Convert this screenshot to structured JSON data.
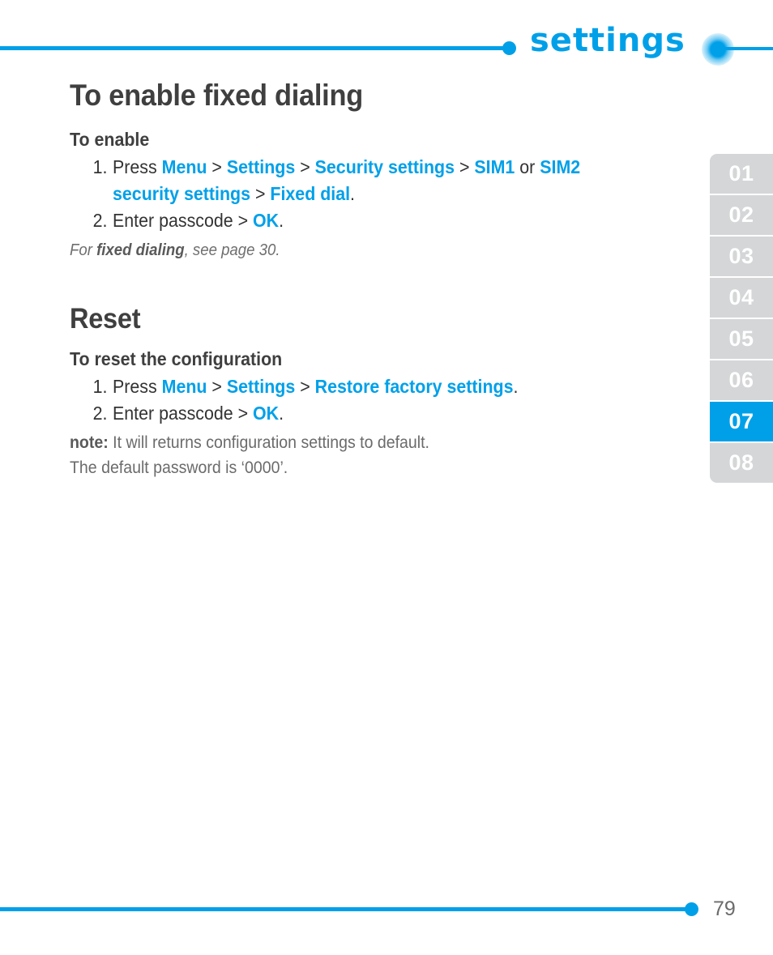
{
  "header": {
    "title": "settings",
    "accent_color": "#00a0e9"
  },
  "main": {
    "page_title": "To enable fixed dialing",
    "enable_section": {
      "sub_heading": "To enable",
      "steps": [
        {
          "num": "1.",
          "parts": [
            {
              "text": "Press ",
              "style": "plain"
            },
            {
              "text": "Menu",
              "style": "hl"
            },
            {
              "text": " > ",
              "style": "sep"
            },
            {
              "text": "Settings",
              "style": "hl"
            },
            {
              "text": " > ",
              "style": "sep"
            },
            {
              "text": "Security settings",
              "style": "hl"
            },
            {
              "text": " > ",
              "style": "sep"
            },
            {
              "text": "SIM1",
              "style": "hl"
            },
            {
              "text": " or ",
              "style": "plain"
            },
            {
              "text": "SIM2 security settings",
              "style": "hl"
            },
            {
              "text": " > ",
              "style": "sep"
            },
            {
              "text": "Fixed dial",
              "style": "hl"
            },
            {
              "text": ".",
              "style": "plain"
            }
          ]
        },
        {
          "num": "2.",
          "parts": [
            {
              "text": "Enter passcode > ",
              "style": "plain"
            },
            {
              "text": "OK",
              "style": "hl"
            },
            {
              "text": ".",
              "style": "plain"
            }
          ]
        }
      ],
      "xref_before": "For ",
      "xref_bold": "fixed dialing",
      "xref_after": ", see page 30."
    },
    "reset_section": {
      "heading": "Reset",
      "sub_heading": "To reset the configuration",
      "steps": [
        {
          "num": "1.",
          "parts": [
            {
              "text": "Press ",
              "style": "plain"
            },
            {
              "text": "Menu",
              "style": "hl"
            },
            {
              "text": " > ",
              "style": "sep"
            },
            {
              "text": "Settings",
              "style": "hl"
            },
            {
              "text": " > ",
              "style": "sep"
            },
            {
              "text": "Restore factory settings",
              "style": "hl"
            },
            {
              "text": ".",
              "style": "plain"
            }
          ]
        },
        {
          "num": "2.",
          "parts": [
            {
              "text": "Enter passcode > ",
              "style": "plain"
            },
            {
              "text": "OK",
              "style": "hl"
            },
            {
              "text": ".",
              "style": "plain"
            }
          ]
        }
      ],
      "note_label": "note:",
      "note_text": " It will returns configuration settings to default.",
      "note_line2": "The default password is ‘0000’."
    }
  },
  "sidebar": {
    "tabs": [
      {
        "label": "01",
        "active": false
      },
      {
        "label": "02",
        "active": false
      },
      {
        "label": "03",
        "active": false
      },
      {
        "label": "04",
        "active": false
      },
      {
        "label": "05",
        "active": false
      },
      {
        "label": "06",
        "active": false
      },
      {
        "label": "07",
        "active": true
      },
      {
        "label": "08",
        "active": false
      }
    ]
  },
  "footer": {
    "page_number": "79"
  }
}
